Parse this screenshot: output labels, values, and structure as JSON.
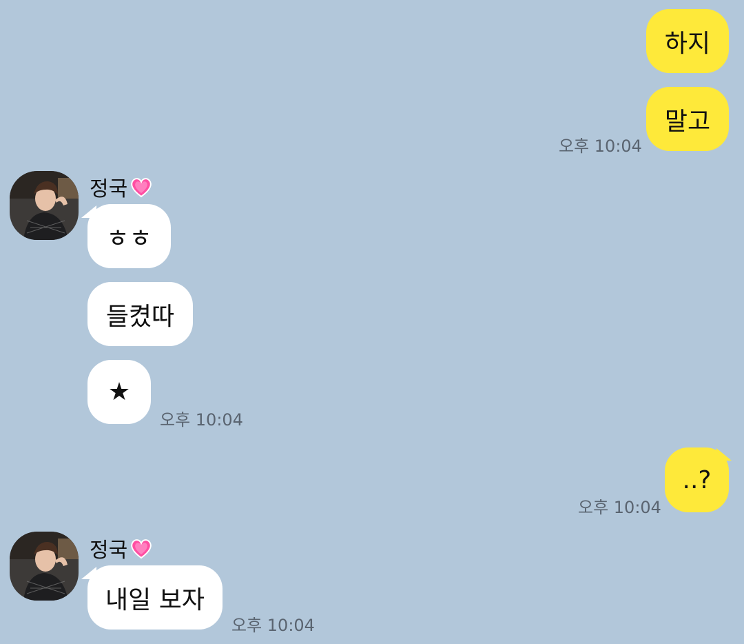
{
  "colors": {
    "background": "#b2c7da",
    "my_bubble": "#fee93a",
    "other_bubble": "#ffffff",
    "time_text": "#5a6470",
    "heart": "#ff4fa3"
  },
  "messages": [
    {
      "from": "me",
      "text": "하지"
    },
    {
      "from": "me",
      "text": "말고",
      "time": "오후 10:04"
    },
    {
      "from": "other",
      "sender": "정국",
      "text": "ㅎㅎ"
    },
    {
      "from": "other",
      "text": "들켰따"
    },
    {
      "from": "other",
      "text": "★",
      "time": "오후 10:04"
    },
    {
      "from": "me",
      "text": "..?",
      "time": "오후 10:04"
    },
    {
      "from": "other",
      "sender": "정국",
      "text": "내일 보자",
      "time": "오후 10:04"
    }
  ],
  "icons": {
    "heart": "pink-heart-emoji",
    "avatar": "profile-photo"
  }
}
